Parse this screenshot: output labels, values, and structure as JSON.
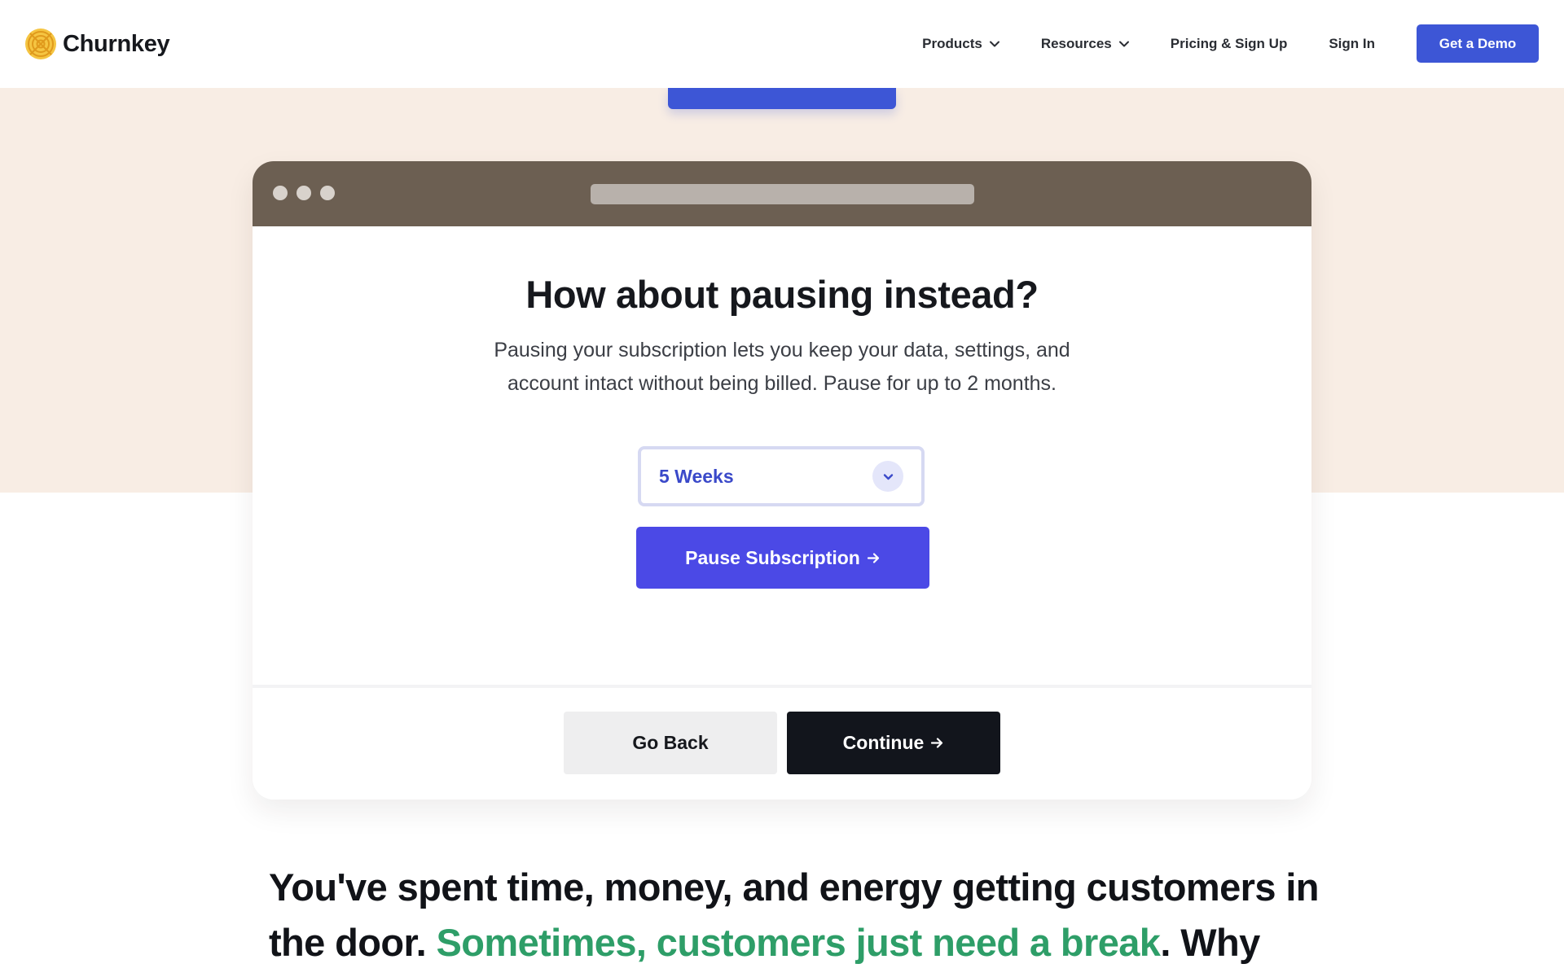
{
  "nav": {
    "brand": "Churnkey",
    "products_label": "Products",
    "resources_label": "Resources",
    "pricing_label": "Pricing & Sign Up",
    "signin_label": "Sign In",
    "demo_label": "Get a Demo"
  },
  "card": {
    "title": "How about pausing instead?",
    "description": "Pausing your subscription lets you keep your data, settings, and account intact without being billed. Pause for up to 2 months.",
    "selected_duration": "5 Weeks",
    "pause_label": "Pause Subscription",
    "back_label": "Go Back",
    "continue_label": "Continue"
  },
  "headline": {
    "lead": "You've spent time, money, and energy getting customers in the door. ",
    "highlight": "Sometimes, customers just need a break",
    "tail": ". Why"
  },
  "colors": {
    "accent": "#3d56d6",
    "pause_button": "#4b49e6",
    "chrome": "#6c5f52",
    "highlight": "#2e9e68",
    "band": "#f8ede4"
  },
  "icons": {
    "logo": "churnkey-logo-icon",
    "nav_chevron": "chevron-down-icon",
    "select_chevron": "chevron-down-icon",
    "button_arrow": "arrow-right-icon"
  }
}
